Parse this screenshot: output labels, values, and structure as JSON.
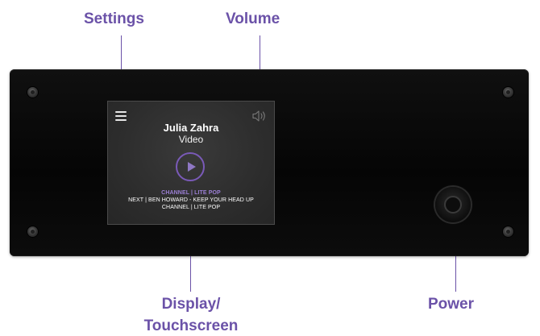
{
  "callouts": {
    "settings": "Settings",
    "volume": "Volume",
    "display_line1": "Display/",
    "display_line2": "Touchscreen",
    "power": "Power"
  },
  "screen": {
    "artist": "Julia Zahra",
    "media_type": "Video",
    "current_channel": "CHANNEL | LITE POP",
    "next_track": "NEXT | BEN HOWARD - KEEP YOUR HEAD UP",
    "next_channel": "CHANNEL | LITE POP"
  },
  "icons": {
    "menu": "hamburger-menu-icon",
    "volume": "speaker-volume-icon",
    "play": "play-icon",
    "power": "power-button-icon"
  },
  "colors": {
    "accent": "#6b52a8",
    "device": "#080808",
    "screen": "#2f2f2f"
  }
}
